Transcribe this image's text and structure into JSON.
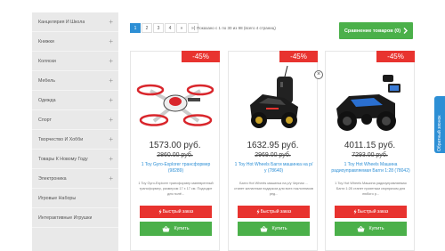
{
  "sidebar": {
    "items": [
      {
        "label": "Канцелярия И Школа",
        "plus": true
      },
      {
        "label": "Книжки",
        "plus": true
      },
      {
        "label": "Коляски",
        "plus": true
      },
      {
        "label": "Мебель",
        "plus": true
      },
      {
        "label": "Одежда",
        "plus": true
      },
      {
        "label": "Спорт",
        "plus": true
      },
      {
        "label": "Творчество И Хобби",
        "plus": true
      },
      {
        "label": "Товары К Новому Году",
        "plus": true
      },
      {
        "label": "Электроника",
        "plus": true
      },
      {
        "label": "Игровые Наборы",
        "plus": false
      },
      {
        "label": "Интерактивные Игрушки",
        "plus": false
      }
    ]
  },
  "pagination": {
    "pages": [
      "1",
      "2",
      "3",
      "4",
      "»",
      "»|"
    ],
    "active": "1",
    "info": "Показано с 1 по 30 из 98 (всего 4 страниц)"
  },
  "compare_button": "Сравнение товаров (0)",
  "products": [
    {
      "discount": "-45%",
      "price": "1573.00 руб.",
      "old_price": "2860.00 руб.",
      "title": "1 Toy Gyro-Explorer трансформер (98289)",
      "description": "1 Toy Gyro-Explorer трансформер маневренный трансформер, размером 17 х 17 см. Подходит для полё...",
      "quick_order": "Быстрый заказ",
      "buy": "Купить"
    },
    {
      "discount": "-45%",
      "price": "1632.95 руб.",
      "old_price": "2969.00 руб.",
      "title": "1 Toy Hot Wheels Багги машинка на р/у (78640)",
      "description": "Багги Hot Wheels машинка на р/у Черная ... станет желанным подарком для всех поклонников ред...",
      "quick_order": "Быстрый заказ",
      "buy": "Купить"
    },
    {
      "discount": "-45%",
      "price": "4011.15 руб.",
      "old_price": "7293.00 руб.",
      "title": "1 Toy Hot Wheels Машина радиоуправляемая Багги 1:28 (78042)",
      "description": "1 Toy Hot Wheels Машина радиоуправляемая Багги 1:28 станет приятным сюрпризом для любого р...",
      "quick_order": "Быстрый заказ",
      "buy": "Купить"
    }
  ],
  "close_symbol": "×",
  "feedback_tab": "Обратный звонок",
  "colors": {
    "red": "#e8332f",
    "green": "#4bb04a",
    "blue": "#2d8fd5",
    "sidebar": "#e9e9e9"
  }
}
